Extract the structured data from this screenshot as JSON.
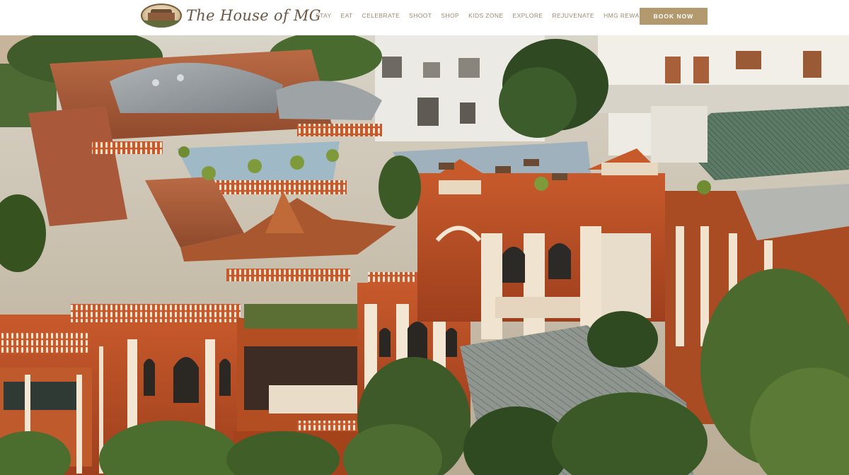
{
  "header": {
    "logo_text": "The House of MG",
    "nav": [
      "STAY",
      "EAT",
      "CELEBRATE",
      "SHOOT",
      "SHOP",
      "KIDS ZONE",
      "EXPLORE",
      "REJUVENATE",
      "HMG REWARDS"
    ],
    "book_button": "BOOK NOW"
  },
  "colors": {
    "accent": "#b39a6e",
    "nav_text": "#9b8a70",
    "header_bg": "#ffffff"
  },
  "hero": {
    "icon": "heritage-building-photo"
  }
}
